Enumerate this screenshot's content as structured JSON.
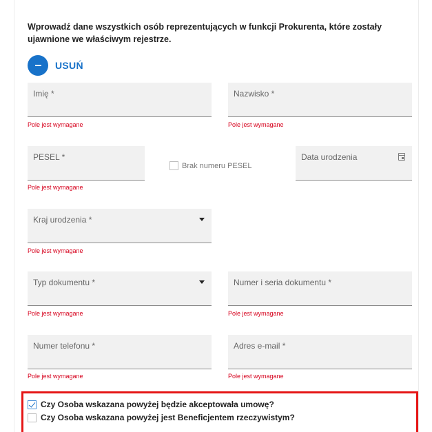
{
  "intro": "Wprowadź dane wszystkich osób reprezentujących w funkcji Prokurenta, które zostały ujawnione we właściwym rejestrze.",
  "remove_label": "USUŃ",
  "fields": {
    "first_name": "Imię *",
    "last_name": "Nazwisko *",
    "pesel": "PESEL *",
    "no_pesel": "Brak numeru PESEL",
    "birth_date": "Data urodzenia",
    "birth_country": "Kraj urodzenia *",
    "doc_type": "Typ dokumentu *",
    "doc_number": "Numer i seria dokumentu *",
    "phone": "Numer telefonu *",
    "email": "Adres e-mail *"
  },
  "error_required": "Pole jest wymagane",
  "questions": {
    "accepts_contract": "Czy Osoba wskazana powyżej będzie akceptowała umowę?",
    "beneficiary": "Czy Osoba wskazana powyżej jest Beneficjentem rzeczywistym?"
  },
  "state": {
    "accepts_contract_checked": true,
    "beneficiary_checked": false,
    "no_pesel_checked": false
  },
  "colors": {
    "accent": "#1872c9",
    "error": "#d6001c",
    "highlight": "#e51616",
    "field_bg": "#f1f1f1"
  }
}
